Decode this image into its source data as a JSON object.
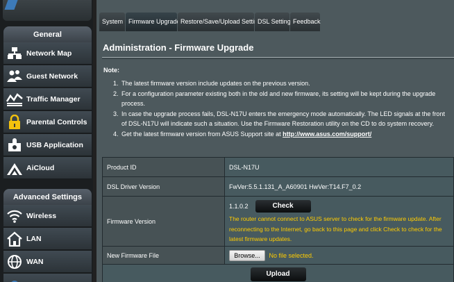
{
  "sidebar": {
    "general_header": "General",
    "general_items": [
      {
        "label": "Network Map",
        "icon": "network-map-icon"
      },
      {
        "label": "Guest Network",
        "icon": "guest-network-icon"
      },
      {
        "label": "Traffic Manager",
        "icon": "traffic-manager-icon"
      },
      {
        "label": "Parental Controls",
        "icon": "parental-controls-icon"
      },
      {
        "label": "USB Application",
        "icon": "usb-application-icon"
      },
      {
        "label": "AiCloud",
        "icon": "aicloud-icon"
      }
    ],
    "advanced_header": "Advanced Settings",
    "advanced_items": [
      {
        "label": "Wireless",
        "icon": "wireless-icon"
      },
      {
        "label": "LAN",
        "icon": "lan-icon"
      },
      {
        "label": "WAN",
        "icon": "wan-icon"
      }
    ]
  },
  "tabs": [
    {
      "label": "System",
      "active": false
    },
    {
      "label": "Firmware Upgrade",
      "active": true
    },
    {
      "label": "Restore/Save/Upload Setting",
      "active": false
    },
    {
      "label": "DSL Setting",
      "active": false
    },
    {
      "label": "Feedback",
      "active": false
    }
  ],
  "page_title": "Administration - Firmware Upgrade",
  "note_label": "Note:",
  "notes": [
    {
      "num": "1.",
      "text": "The latest firmware version include updates on the previous version."
    },
    {
      "num": "2.",
      "text": "For a configuration parameter existing both in the old and new firmware, its setting will be kept during the upgrade process."
    },
    {
      "num": "3.",
      "text": "In case the upgrade process fails, DSL-N17U enters the emergency mode automatically. The LED signals at the front of DSL-N17U will indicate such a situation. Use the Firmware Restoration utility on the CD to do system recovery."
    },
    {
      "num": "4.",
      "text": "Get the latest firmware version from ASUS Support site at ",
      "link": "http://www.asus.com/support/"
    }
  ],
  "table": {
    "product_id_label": "Product ID",
    "product_id_value": "DSL-N17U",
    "driver_label": "DSL Driver Version",
    "driver_value": "FwVer:5.5.1.131_A_A60901 HwVer:T14.F7_0.2",
    "fw_label": "Firmware Version",
    "fw_value": "1.1.0.2",
    "check_label": "Check",
    "fw_warning": "The router cannot connect to ASUS server to check for the firmware update. After reconnecting to the Internet, go back to this page and click Check to check for the latest firmware updates.",
    "new_fw_label": "New Firmware File",
    "browse_label": "Browse...",
    "no_file": "No file selected.",
    "upload_label": "Upload"
  },
  "colors": {
    "warning": "#ffcc00",
    "panel": "#4d595d"
  }
}
